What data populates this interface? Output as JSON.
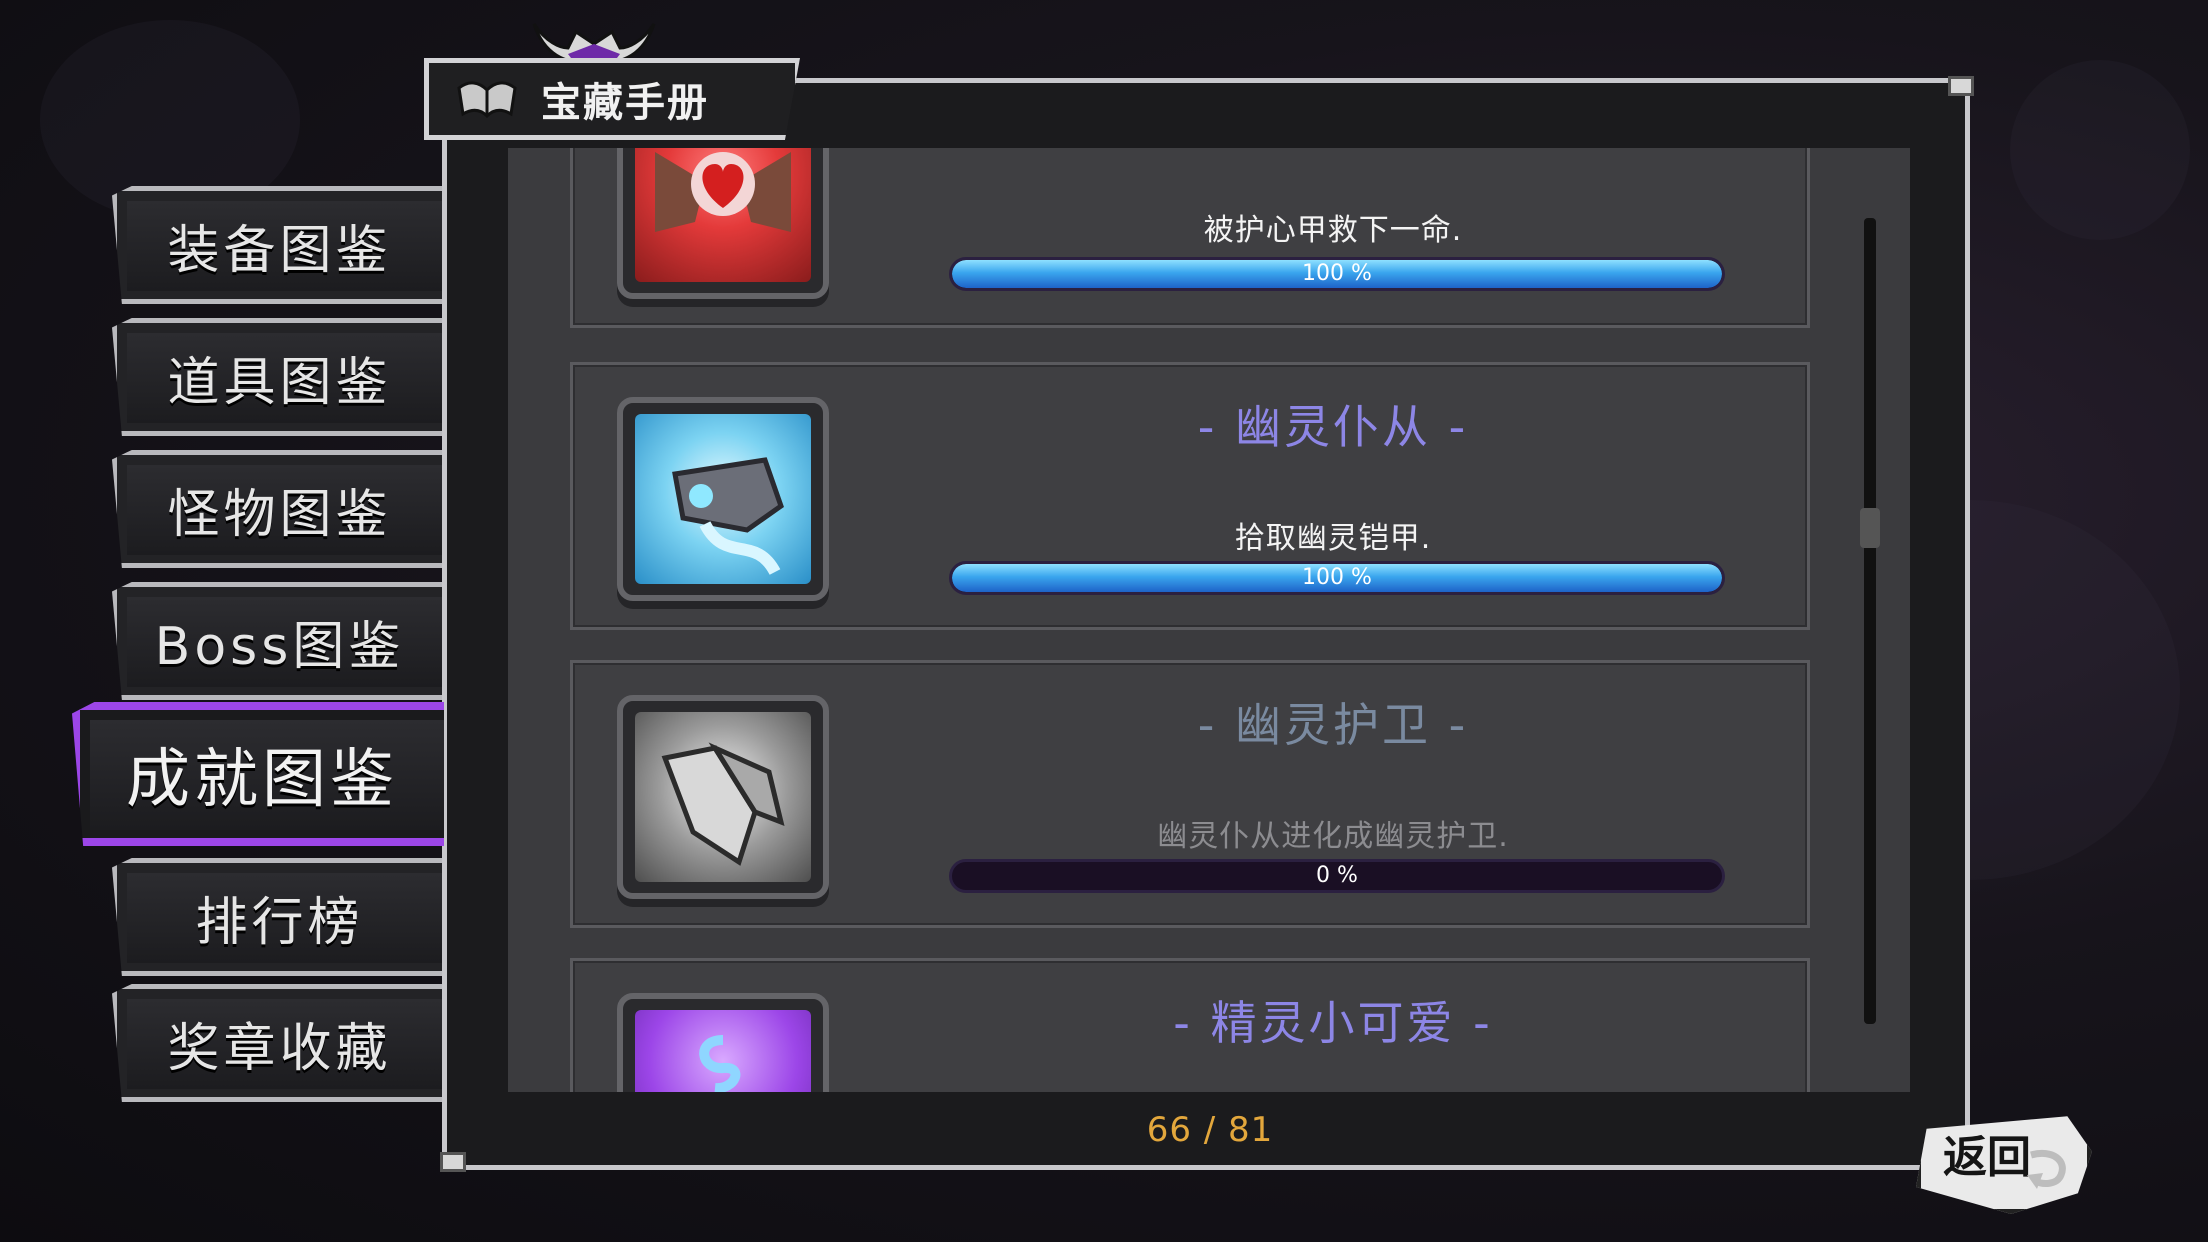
{
  "header": {
    "title": "宝藏手册"
  },
  "sidebar": {
    "tabs": [
      {
        "label": "装备图鉴"
      },
      {
        "label": "道具图鉴"
      },
      {
        "label": "怪物图鉴"
      },
      {
        "label": "Boss图鉴"
      },
      {
        "label": "成就图鉴",
        "active": true
      },
      {
        "label": "排行榜"
      },
      {
        "label": "奖章收藏"
      }
    ]
  },
  "achievements": [
    {
      "title": "",
      "description": "被护心甲救下一命.",
      "progress": 100,
      "progress_label": "100 %",
      "icon": "heart-armor-icon"
    },
    {
      "title": "- 幽灵仆从 -",
      "description": "拾取幽灵铠甲.",
      "progress": 100,
      "progress_label": "100 %",
      "icon": "ghost-armor-icon"
    },
    {
      "title": "- 幽灵护卫 -",
      "description": "幽灵仆从进化成幽灵护卫.",
      "progress": 0,
      "progress_label": "0 %",
      "icon": "ghost-guard-icon"
    },
    {
      "title": "- 精灵小可爱 -",
      "icon": "spirit-icon"
    }
  ],
  "footer": {
    "count": "66 / 81",
    "back_label": "返回"
  },
  "colors": {
    "accent": "#9c46e8",
    "progress": "#3aa6ee",
    "count": "#e3a73c"
  }
}
